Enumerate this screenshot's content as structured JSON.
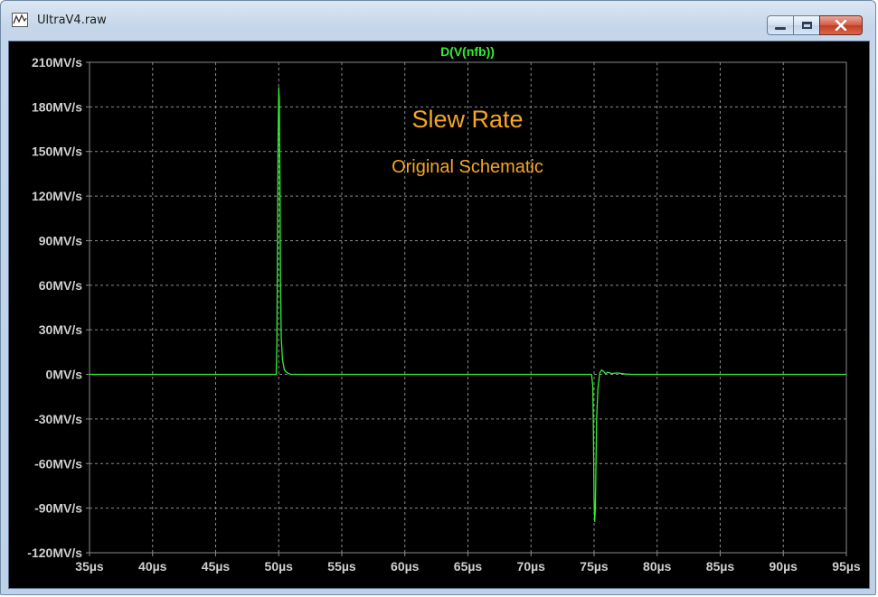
{
  "window": {
    "title": "UltraV4.raw",
    "icon": "waveform-icon",
    "minimize_icon": "minimize-icon",
    "maximize_icon": "maximize-icon",
    "close_icon": "close-icon"
  },
  "colors": {
    "background": "#000000",
    "trace": "#33ee33",
    "annotation": "#f5a623",
    "tick_text": "#cfcfcf",
    "grid": "#8a8a8a"
  },
  "chart_data": {
    "type": "line",
    "title": "D(V(nfb))",
    "annotations": [
      "Slew Rate",
      "Original Schematic"
    ],
    "xlabel": "",
    "ylabel": "",
    "x_unit": "µs",
    "y_unit": "MV/s",
    "xlim": [
      35,
      95
    ],
    "ylim": [
      -120,
      210
    ],
    "x_ticks": [
      35,
      40,
      45,
      50,
      55,
      60,
      65,
      70,
      75,
      80,
      85,
      90,
      95
    ],
    "x_tick_labels": [
      "35µs",
      "40µs",
      "45µs",
      "50µs",
      "55µs",
      "60µs",
      "65µs",
      "70µs",
      "75µs",
      "80µs",
      "85µs",
      "90µs",
      "95µs"
    ],
    "y_ticks": [
      210,
      180,
      150,
      120,
      90,
      60,
      30,
      0,
      -30,
      -60,
      -90,
      -120
    ],
    "y_tick_labels": [
      "210MV/s",
      "180MV/s",
      "150MV/s",
      "120MV/s",
      "90MV/s",
      "60MV/s",
      "30MV/s",
      "0MV/s",
      "-30MV/s",
      "-60MV/s",
      "-90MV/s",
      "-120MV/s"
    ],
    "grid": true,
    "series": [
      {
        "name": "D(V(nfb))",
        "x": [
          35,
          49.8,
          49.85,
          49.9,
          49.95,
          50.0,
          50.05,
          50.1,
          50.15,
          50.2,
          50.3,
          50.45,
          50.6,
          50.8,
          51.0,
          52.0,
          74.8,
          74.9,
          74.95,
          75.0,
          75.05,
          75.1,
          75.15,
          75.2,
          75.3,
          75.45,
          75.6,
          75.75,
          75.9,
          76.1,
          76.4,
          76.8,
          77.2,
          77.5,
          78.0,
          95
        ],
        "y": [
          0,
          0,
          20,
          90,
          160,
          193,
          185,
          130,
          60,
          25,
          10,
          3,
          1.5,
          0.5,
          0,
          0,
          0,
          -8,
          -40,
          -85,
          -99,
          -90,
          -60,
          -30,
          -10,
          1,
          3,
          2,
          0.5,
          1.5,
          0.5,
          1,
          0.5,
          0.2,
          0,
          0
        ]
      }
    ]
  }
}
